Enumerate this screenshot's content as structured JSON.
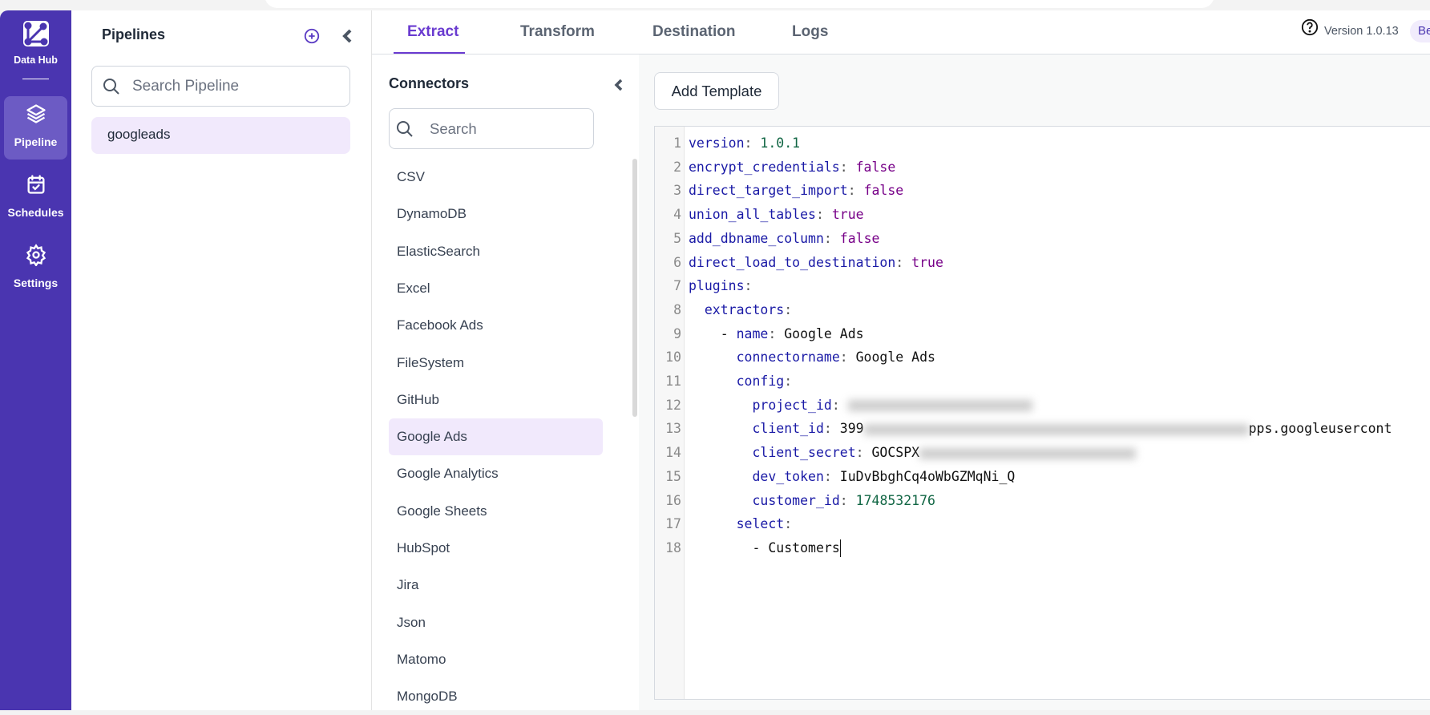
{
  "sidebar": {
    "brand": "Data Hub",
    "items": [
      {
        "label": "Pipeline",
        "icon": "layers-icon"
      },
      {
        "label": "Schedules",
        "icon": "calendar-check-icon"
      },
      {
        "label": "Settings",
        "icon": "gear-icon"
      }
    ]
  },
  "pipelines": {
    "title": "Pipelines",
    "search_placeholder": "Search Pipeline",
    "items": [
      "googleads"
    ]
  },
  "tabs": [
    "Extract",
    "Transform",
    "Destination",
    "Logs"
  ],
  "header": {
    "version": "Version 1.0.13",
    "badge": "Be"
  },
  "connectors": {
    "title": "Connectors",
    "search_placeholder": "Search",
    "items": [
      "CSV",
      "DynamoDB",
      "ElasticSearch",
      "Excel",
      "Facebook Ads",
      "FileSystem",
      "GitHub",
      "Google Ads",
      "Google Analytics",
      "Google Sheets",
      "HubSpot",
      "Jira",
      "Json",
      "Matomo",
      "MongoDB"
    ],
    "selected": "Google Ads"
  },
  "editor": {
    "add_template": "Add Template",
    "lines": [
      [
        [
          "k",
          "version"
        ],
        [
          "p",
          ": "
        ],
        [
          "n",
          "1.0.1"
        ]
      ],
      [
        [
          "k",
          "encrypt_credentials"
        ],
        [
          "p",
          ": "
        ],
        [
          "b",
          "false"
        ]
      ],
      [
        [
          "k",
          "direct_target_import"
        ],
        [
          "p",
          ": "
        ],
        [
          "b",
          "false"
        ]
      ],
      [
        [
          "k",
          "union_all_tables"
        ],
        [
          "p",
          ": "
        ],
        [
          "b",
          "true"
        ]
      ],
      [
        [
          "k",
          "add_dbname_column"
        ],
        [
          "p",
          ": "
        ],
        [
          "b",
          "false"
        ]
      ],
      [
        [
          "k",
          "direct_load_to_destination"
        ],
        [
          "p",
          ": "
        ],
        [
          "b",
          "true"
        ]
      ],
      [
        [
          "k",
          "plugins"
        ],
        [
          "p",
          ":"
        ]
      ],
      [
        [
          "s",
          "  "
        ],
        [
          "k",
          "extractors"
        ],
        [
          "p",
          ":"
        ]
      ],
      [
        [
          "s",
          "    - "
        ],
        [
          "k",
          "name"
        ],
        [
          "p",
          ": "
        ],
        [
          "s",
          "Google Ads"
        ]
      ],
      [
        [
          "s",
          "      "
        ],
        [
          "k",
          "connectorname"
        ],
        [
          "p",
          ": "
        ],
        [
          "s",
          "Google Ads"
        ]
      ],
      [
        [
          "s",
          "      "
        ],
        [
          "k",
          "config"
        ],
        [
          "p",
          ":"
        ]
      ],
      [
        [
          "s",
          "        "
        ],
        [
          "k",
          "project_id"
        ],
        [
          "p",
          ": "
        ],
        [
          "blur",
          "230"
        ]
      ],
      [
        [
          "s",
          "        "
        ],
        [
          "k",
          "client_id"
        ],
        [
          "p",
          ": "
        ],
        [
          "s",
          "399"
        ],
        [
          "blur",
          "480"
        ],
        [
          "s",
          "pps.googleusercont"
        ]
      ],
      [
        [
          "s",
          "        "
        ],
        [
          "k",
          "client_secret"
        ],
        [
          "p",
          ": "
        ],
        [
          "s",
          "GOCSPX"
        ],
        [
          "blur",
          "270"
        ]
      ],
      [
        [
          "s",
          "        "
        ],
        [
          "k",
          "dev_token"
        ],
        [
          "p",
          ": "
        ],
        [
          "s",
          "IuDvBbghCq4oWbGZMqNi_Q"
        ]
      ],
      [
        [
          "s",
          "        "
        ],
        [
          "k",
          "customer_id"
        ],
        [
          "p",
          ": "
        ],
        [
          "n",
          "1748532176"
        ]
      ],
      [
        [
          "s",
          "      "
        ],
        [
          "k",
          "select"
        ],
        [
          "p",
          ":"
        ]
      ],
      [
        [
          "s",
          "        - "
        ],
        [
          "s",
          "Customers"
        ],
        [
          "caret",
          ""
        ]
      ]
    ]
  }
}
